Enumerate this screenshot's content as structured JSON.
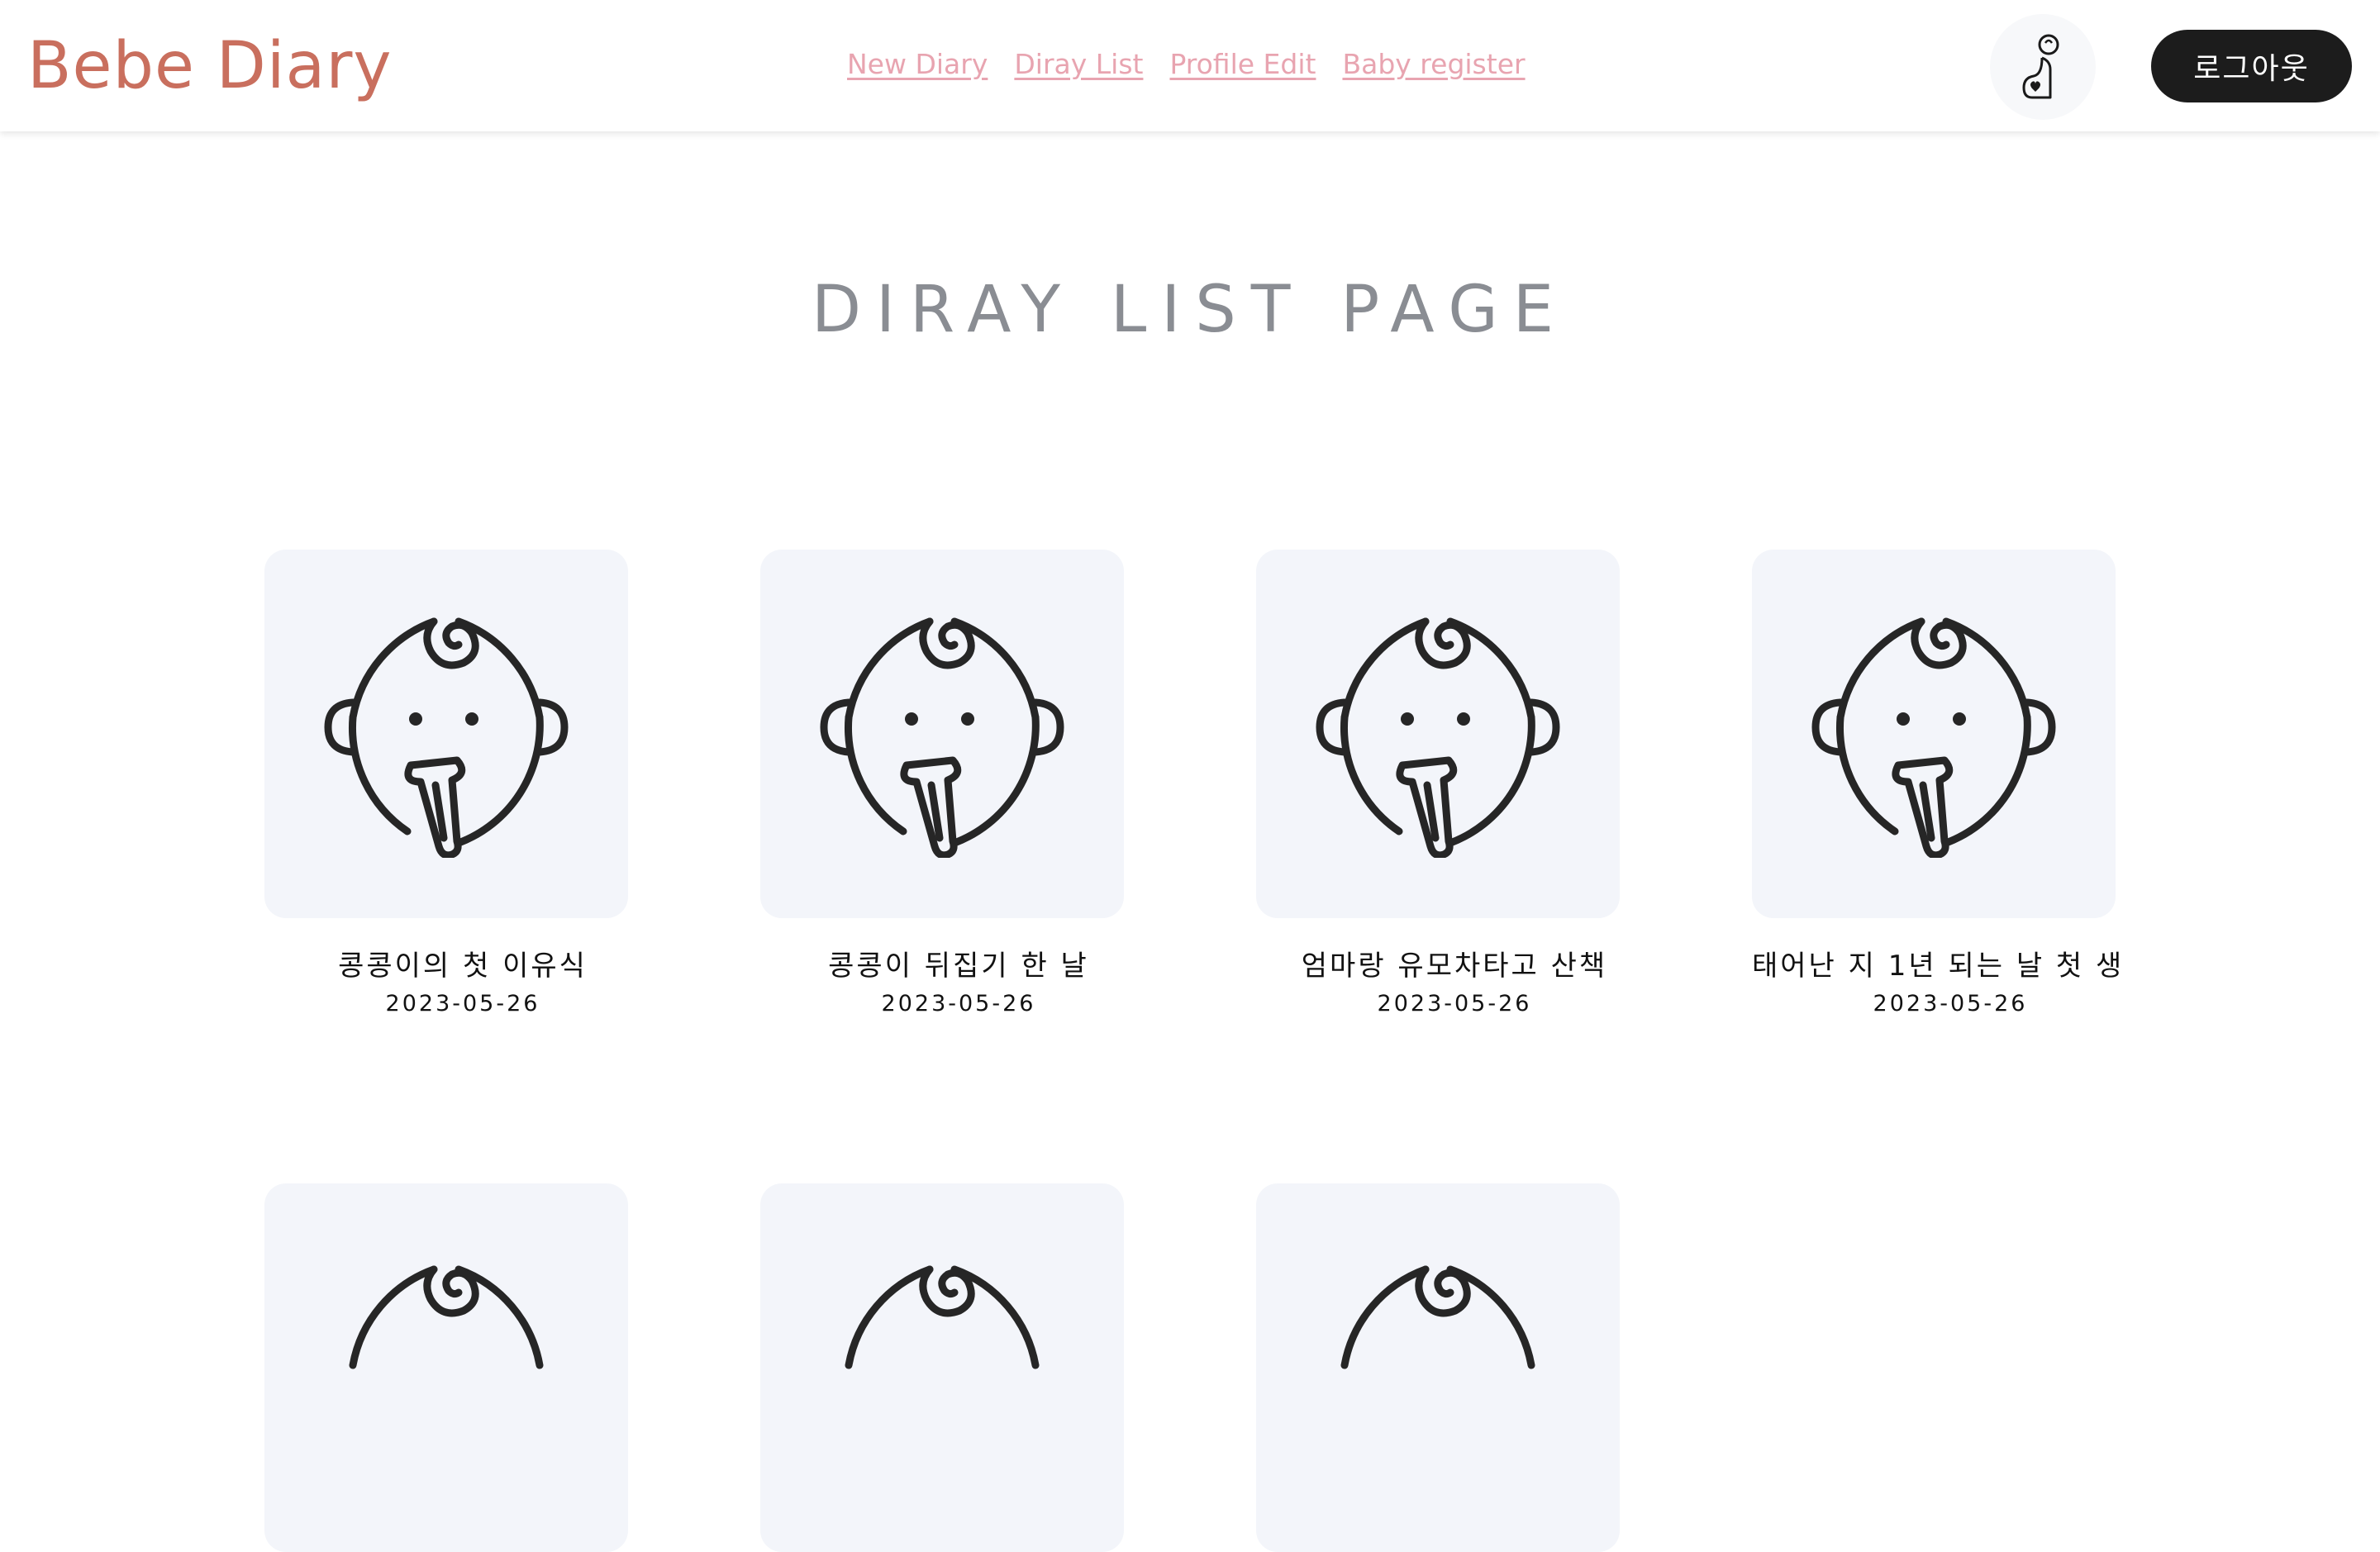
{
  "header": {
    "brand": "Bebe Diary",
    "nav": [
      {
        "label": "New Diary"
      },
      {
        "label": "Diray List"
      },
      {
        "label": "Profile Edit"
      },
      {
        "label": "Baby register"
      }
    ],
    "logout_label": "로그아웃"
  },
  "main": {
    "title": "DIRAY LIST PAGE",
    "diaries": [
      {
        "title": "콩콩이의 첫 이유식",
        "date": "2023-05-26"
      },
      {
        "title": "콩콩이 뒤집기 한 날",
        "date": "2023-05-26"
      },
      {
        "title": "엄마랑 유모차타고 산책",
        "date": "2023-05-26"
      },
      {
        "title": "태어난 지 1년 되는 날 첫 생",
        "date": "2023-05-26"
      },
      {
        "title": "",
        "date": ""
      },
      {
        "title": "",
        "date": ""
      },
      {
        "title": "",
        "date": ""
      }
    ]
  },
  "icons": {
    "profile": "baby-profile-icon",
    "thumbnail": "baby-feeding-icon"
  },
  "colors": {
    "brand": "#c96f5e",
    "nav_link": "#e8a4b0",
    "logout_bg": "#1c1c1c",
    "card_bg": "#f3f5fa",
    "title_text": "#8a8d93"
  }
}
